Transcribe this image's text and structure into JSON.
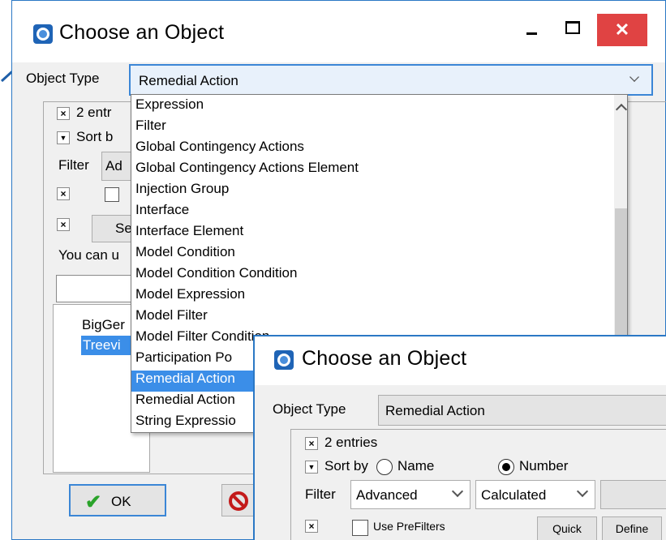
{
  "main_dialog": {
    "title": "Choose an Object",
    "close_glyph": "✕",
    "object_type_label": "Object Type",
    "object_type_value": "Remedial Action",
    "entries_text": "2 entr",
    "sort_text": "Sort b",
    "filter_label": "Filter",
    "filter_value": "Ad",
    "select_button": "Se",
    "hint_text": "You can u",
    "list_items": [
      "BigGer",
      "Treevi"
    ],
    "ok_label": "OK"
  },
  "dropdown": {
    "items": [
      "Expression",
      "Filter",
      "Global Contingency Actions",
      "Global Contingency Actions Element",
      "Injection Group",
      "Interface",
      "Interface Element",
      "Model Condition",
      "Model Condition Condition",
      "Model Expression",
      "Model Filter",
      "Model Filter Condition",
      "Participation Po",
      "Remedial Action",
      "Remedial Action",
      "String Expressio"
    ],
    "selected_index": 13
  },
  "inset_dialog": {
    "title": "Choose an Object",
    "object_type_label": "Object Type",
    "object_type_value": "Remedial Action",
    "entries_text": "2 entries",
    "sort_by_label": "Sort by",
    "radio_name_label": "Name",
    "radio_number_label": "Number",
    "filter_label": "Filter",
    "filter_advanced": "Advanced",
    "filter_calculated": "Calculated",
    "use_prefilters_label": "Use PreFilters",
    "quick_button": "Quick",
    "define_button": "Define"
  },
  "colors": {
    "accent": "#2b78c5",
    "selection": "#3b8ee8",
    "close_red": "#e04343"
  },
  "icons": [
    "app-logo-icon",
    "minimize-icon",
    "maximize-icon",
    "close-icon",
    "chevron-down-icon",
    "chevron-up-icon",
    "checkmark-icon",
    "no-entry-icon",
    "arrow-icon"
  ]
}
